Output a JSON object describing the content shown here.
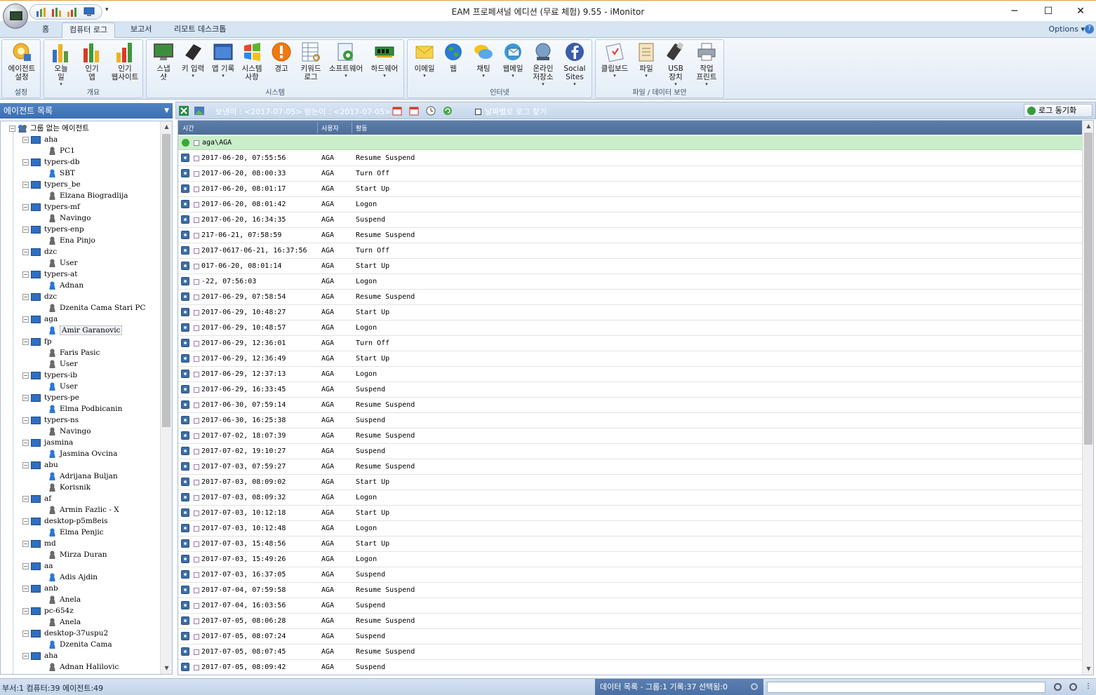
{
  "window": {
    "title": "EAM 프로페셔널 에디션 (무료 체험) 9.55 - iMonitor",
    "minimize": "─",
    "maximize": "☐",
    "close": "✕"
  },
  "tabs": [
    "홈",
    "컴퓨터 로그",
    "보고서",
    "리모트 데스크톱"
  ],
  "options_label": "Options",
  "ribbon": {
    "groups": [
      {
        "label": "설정",
        "buttons": [
          {
            "label": "에이전트\n설정",
            "icon": "agent-settings-icon"
          }
        ]
      },
      {
        "label": "개요",
        "buttons": [
          {
            "label": "오늘\n일",
            "icon": "bar-chart-icon",
            "dropdown": true
          },
          {
            "label": "인기\n앱",
            "icon": "bar-chart-icon",
            "dropdown": false
          },
          {
            "label": "인기\n웹사이트",
            "icon": "bar-chart-icon",
            "dropdown": false
          }
        ]
      },
      {
        "label": "시스템",
        "buttons": [
          {
            "label": "스냅\n샷",
            "icon": "snapshot-icon"
          },
          {
            "label": "키 입력",
            "icon": "keyboard-icon",
            "dropdown": true
          },
          {
            "label": "앱 기록",
            "icon": "window-icon",
            "dropdown": true
          },
          {
            "label": "시스템\n사항",
            "icon": "windows-icon"
          },
          {
            "label": "경고",
            "icon": "warning-icon"
          },
          {
            "label": "키워드\n로그",
            "icon": "keyword-log-icon"
          },
          {
            "label": "소프트웨어",
            "icon": "software-icon",
            "dropdown": true
          },
          {
            "label": "하드웨어",
            "icon": "hardware-icon",
            "dropdown": true
          }
        ]
      },
      {
        "label": "인터넷",
        "buttons": [
          {
            "label": "이메일",
            "icon": "email-icon",
            "dropdown": true
          },
          {
            "label": "웹",
            "icon": "globe-icon"
          },
          {
            "label": "채팅",
            "icon": "chat-icon",
            "dropdown": true
          },
          {
            "label": "웹메일",
            "icon": "webmail-icon",
            "dropdown": true
          },
          {
            "label": "온라인\n저장소",
            "icon": "online-storage-icon",
            "dropdown": true
          },
          {
            "label": "Social\nSites",
            "icon": "facebook-icon",
            "dropdown": true
          }
        ]
      },
      {
        "label": "파일 / 데이터 보안",
        "buttons": [
          {
            "label": "클립보드",
            "icon": "clipboard-icon",
            "dropdown": true
          },
          {
            "label": "파일",
            "icon": "file-icon",
            "dropdown": true
          },
          {
            "label": "USB\n장치",
            "icon": "usb-icon",
            "dropdown": true
          },
          {
            "label": "작업\n프린트",
            "icon": "printer-icon",
            "dropdown": true
          }
        ]
      }
    ]
  },
  "left_panel": {
    "title": "에이전트 목록",
    "root": "그룹 없는 에이전트",
    "computers": [
      {
        "name": "aha",
        "users": [
          {
            "name": "PC1",
            "online": false
          }
        ]
      },
      {
        "name": "typers-db",
        "users": [
          {
            "name": "SBT",
            "online": true
          }
        ]
      },
      {
        "name": "typers_be",
        "users": [
          {
            "name": "Elzana Biogradlija",
            "online": false
          }
        ]
      },
      {
        "name": "typers-mf",
        "users": [
          {
            "name": "Navingo",
            "online": false
          }
        ]
      },
      {
        "name": "typers-enp",
        "users": [
          {
            "name": "Ena Pinjo",
            "online": false
          }
        ]
      },
      {
        "name": "dzc",
        "users": [
          {
            "name": "User",
            "online": false
          }
        ]
      },
      {
        "name": "typers-at",
        "users": [
          {
            "name": "Adnan",
            "online": true
          }
        ]
      },
      {
        "name": "dzc",
        "users": [
          {
            "name": "Dzenita Cama Stari PC",
            "online": false
          }
        ]
      },
      {
        "name": "aga",
        "users": [
          {
            "name": "Amir Garanovic",
            "online": true,
            "selected": true
          }
        ]
      },
      {
        "name": "fp",
        "users": [
          {
            "name": "Faris Pasic",
            "online": false
          },
          {
            "name": "User",
            "online": false
          }
        ]
      },
      {
        "name": "typers-ib",
        "users": [
          {
            "name": "User",
            "online": true
          }
        ]
      },
      {
        "name": "typers-pe",
        "users": [
          {
            "name": "Elma Podbicanin",
            "online": true
          }
        ]
      },
      {
        "name": "typers-ns",
        "users": [
          {
            "name": "Navingo",
            "online": false
          }
        ]
      },
      {
        "name": "jasmina",
        "users": [
          {
            "name": "Jasmina Ovcina",
            "online": true
          }
        ]
      },
      {
        "name": "abu",
        "users": [
          {
            "name": "Adrijana Buljan",
            "online": true
          },
          {
            "name": "Korisnik",
            "online": false
          }
        ]
      },
      {
        "name": "af",
        "users": [
          {
            "name": "Armin Fazlic - X",
            "online": false
          }
        ]
      },
      {
        "name": "desktop-p5m8eis",
        "users": [
          {
            "name": "Elma Penjic",
            "online": true
          }
        ]
      },
      {
        "name": "md",
        "users": [
          {
            "name": "Mirza Duran",
            "online": false
          }
        ]
      },
      {
        "name": "aa",
        "users": [
          {
            "name": "Adis Ajdin",
            "online": true
          }
        ]
      },
      {
        "name": "anb",
        "users": [
          {
            "name": "Anela",
            "online": false
          }
        ]
      },
      {
        "name": "pc-654z",
        "users": [
          {
            "name": "Anela",
            "online": false
          }
        ]
      },
      {
        "name": "desktop-37uspu2",
        "users": [
          {
            "name": "Dzenita Cama",
            "online": true
          }
        ]
      },
      {
        "name": "aha",
        "users": [
          {
            "name": "Adnan Halilovic",
            "online": false
          }
        ]
      }
    ]
  },
  "toolbar": {
    "range": "보낸이 : <2017-07-05> 받는이 : <2017-07-05>",
    "date_search": "날짜별로 로그 찾기",
    "sync": "로그 동기화"
  },
  "grid": {
    "columns": [
      "시간",
      "사용자",
      "활동"
    ],
    "group": "aga\\AGA",
    "rows": [
      [
        "2017-06-20, 07:55:56",
        "AGA",
        "Resume Suspend"
      ],
      [
        "2017-06-20, 08:00:33",
        "AGA",
        "Turn Off"
      ],
      [
        "2017-06-20, 08:01:17",
        "AGA",
        "Start Up"
      ],
      [
        "2017-06-20, 08:01:42",
        "AGA",
        "Logon"
      ],
      [
        "2017-06-20, 16:34:35",
        "AGA",
        "Suspend"
      ],
      [
        "217-06-21, 07:58:59",
        "AGA",
        "Resume Suspend"
      ],
      [
        "2017-0617-06-21, 16:37:56",
        "AGA",
        "Turn Off"
      ],
      [
        "017-06-20, 08:01:14",
        "AGA",
        "Start Up"
      ],
      [
        "-22, 07:56:03",
        "AGA",
        "Logon"
      ],
      [
        "2017-06-29, 07:58:54",
        "AGA",
        "Resume Suspend"
      ],
      [
        "2017-06-29, 10:48:27",
        "AGA",
        "Start Up"
      ],
      [
        "2017-06-29, 10:48:57",
        "AGA",
        "Logon"
      ],
      [
        "2017-06-29, 12:36:01",
        "AGA",
        "Turn Off"
      ],
      [
        "2017-06-29, 12:36:49",
        "AGA",
        "Start Up"
      ],
      [
        "2017-06-29, 12:37:13",
        "AGA",
        "Logon"
      ],
      [
        "2017-06-29, 16:33:45",
        "AGA",
        "Suspend"
      ],
      [
        "2017-06-30, 07:59:14",
        "AGA",
        "Resume Suspend"
      ],
      [
        "2017-06-30, 16:25:38",
        "AGA",
        "Suspend"
      ],
      [
        "2017-07-02, 18:07:39",
        "AGA",
        "Resume Suspend"
      ],
      [
        "2017-07-02, 19:10:27",
        "AGA",
        "Suspend"
      ],
      [
        "2017-07-03, 07:59:27",
        "AGA",
        "Resume Suspend"
      ],
      [
        "2017-07-03, 08:09:02",
        "AGA",
        "Start Up"
      ],
      [
        "2017-07-03, 08:09:32",
        "AGA",
        "Logon"
      ],
      [
        "2017-07-03, 10:12:18",
        "AGA",
        "Start Up"
      ],
      [
        "2017-07-03, 10:12:48",
        "AGA",
        "Logon"
      ],
      [
        "2017-07-03, 15:48:56",
        "AGA",
        "Start Up"
      ],
      [
        "2017-07-03, 15:49:26",
        "AGA",
        "Logon"
      ],
      [
        "2017-07-03, 16:37:05",
        "AGA",
        "Suspend"
      ],
      [
        "2017-07-04, 07:59:58",
        "AGA",
        "Resume Suspend"
      ],
      [
        "2017-07-04, 16:03:56",
        "AGA",
        "Suspend"
      ],
      [
        "2017-07-05, 08:06:28",
        "AGA",
        "Resume Suspend"
      ],
      [
        "2017-07-05, 08:07:24",
        "AGA",
        "Suspend"
      ],
      [
        "2017-07-05, 08:07:45",
        "AGA",
        "Resume Suspend"
      ],
      [
        "2017-07-05, 08:09:42",
        "AGA",
        "Suspend"
      ]
    ]
  },
  "status": {
    "left": "부서:1  컴퓨터:39  에이전트:49",
    "right": "데이터 목록 - 그룹:1  기록:37  선택됨:0"
  }
}
